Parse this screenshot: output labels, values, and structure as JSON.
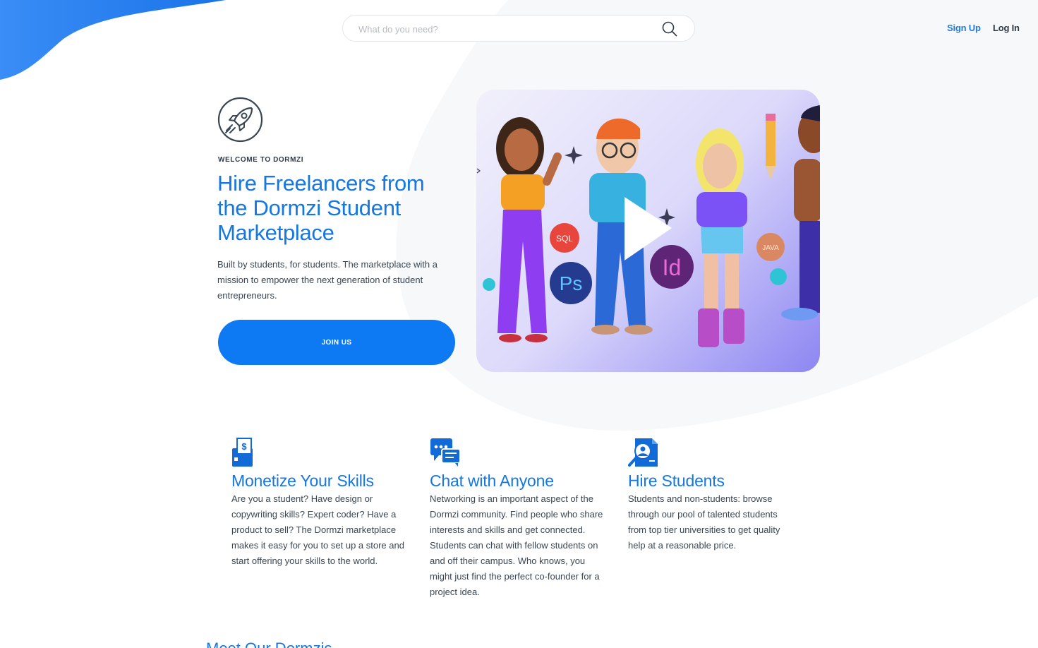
{
  "header": {
    "search": {
      "placeholder": "What do you need?"
    },
    "nav": {
      "signup": "Sign Up",
      "login": "Log In"
    }
  },
  "hero": {
    "eyebrow": "WELCOME TO DORMZI",
    "title": "Hire Freelancers from the Dormzi Student Marketplace",
    "subtitle": "Built by students, for students. The marketplace with a mission to empower the next generation of student entrepreneurs.",
    "cta": "JOIN US",
    "video_badges": [
      "SQL",
      "Ps",
      "Id",
      "JAVA"
    ]
  },
  "features": [
    {
      "icon": "wallet-icon",
      "title": "Monetize Your Skills",
      "text": "Are you a student? Have design or copywriting skills? Expert coder? Have a product to sell? The Dormzi marketplace makes it easy for you to set up a store and start offering your skills to the world."
    },
    {
      "icon": "chat-icon",
      "title": "Chat with Anyone",
      "text": "Networking is an important aspect of the Dormzi community. Find people who share interests and skills and get connected. Students can chat with fellow students on and off their campus. Who knows, you might just find the perfect co-founder for a project idea."
    },
    {
      "icon": "search-profile-icon",
      "title": "Hire Students",
      "text": "Students and non-students: browse through our pool of talented students from top tier universities to get quality help at a reasonable price."
    }
  ],
  "next_section": {
    "heading": "Meet Our Dormzis"
  },
  "colors": {
    "accent": "#1577e2",
    "button": "#0d79f2",
    "text": "#3b4652"
  }
}
